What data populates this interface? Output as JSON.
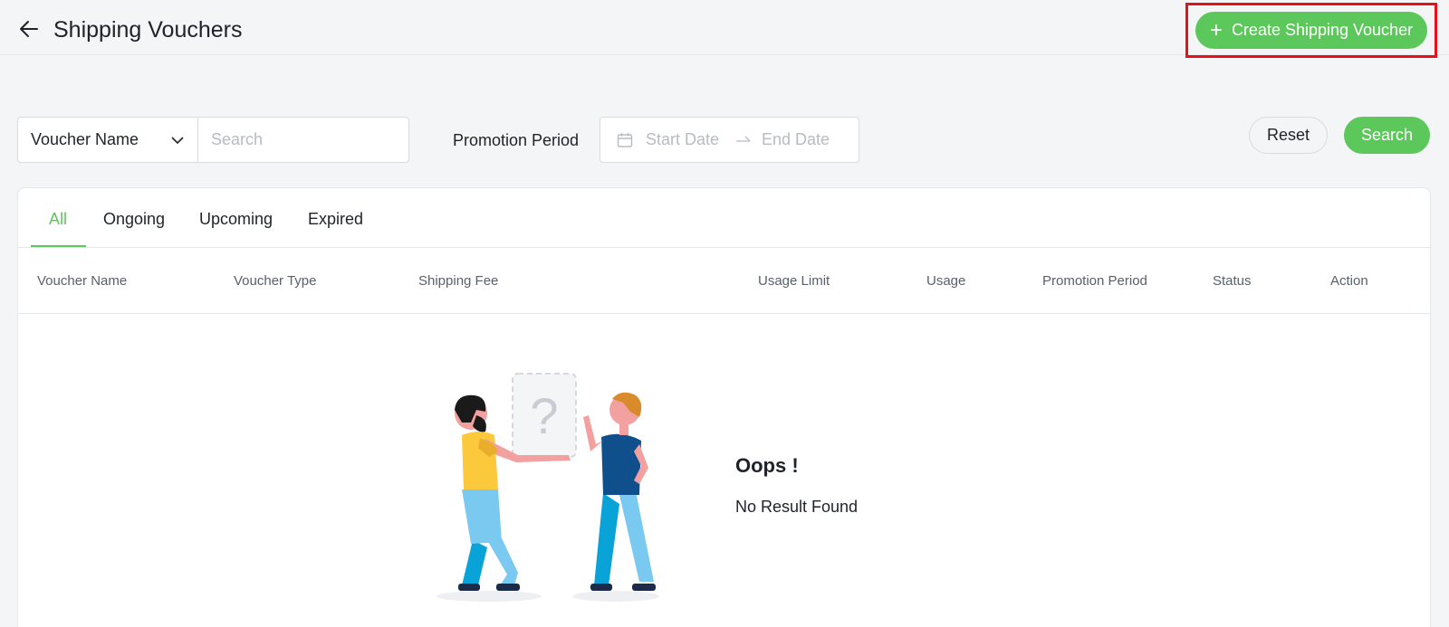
{
  "header": {
    "title": "Shipping Vouchers",
    "back_icon": "arrow-left-icon",
    "create_button_label": "Create Shipping Voucher",
    "create_button_icon": "plus-icon"
  },
  "filters": {
    "field_select_value": "Voucher Name",
    "search_placeholder": "Search",
    "promotion_period_label": "Promotion Period",
    "start_date_placeholder": "Start Date",
    "end_date_placeholder": "End Date",
    "reset_label": "Reset",
    "search_label": "Search"
  },
  "tabs": [
    {
      "label": "All",
      "active": true
    },
    {
      "label": "Ongoing",
      "active": false
    },
    {
      "label": "Upcoming",
      "active": false
    },
    {
      "label": "Expired",
      "active": false
    }
  ],
  "table": {
    "columns": [
      "Voucher Name",
      "Voucher Type",
      "Shipping Fee",
      "Usage Limit",
      "Usage",
      "Promotion Period",
      "Status",
      "Action"
    ]
  },
  "empty_state": {
    "title": "Oops !",
    "message": "No Result Found",
    "illustration_mark": "?"
  },
  "colors": {
    "accent": "#5cc75a",
    "highlight": "#e8101a",
    "background": "#f4f5f7"
  }
}
